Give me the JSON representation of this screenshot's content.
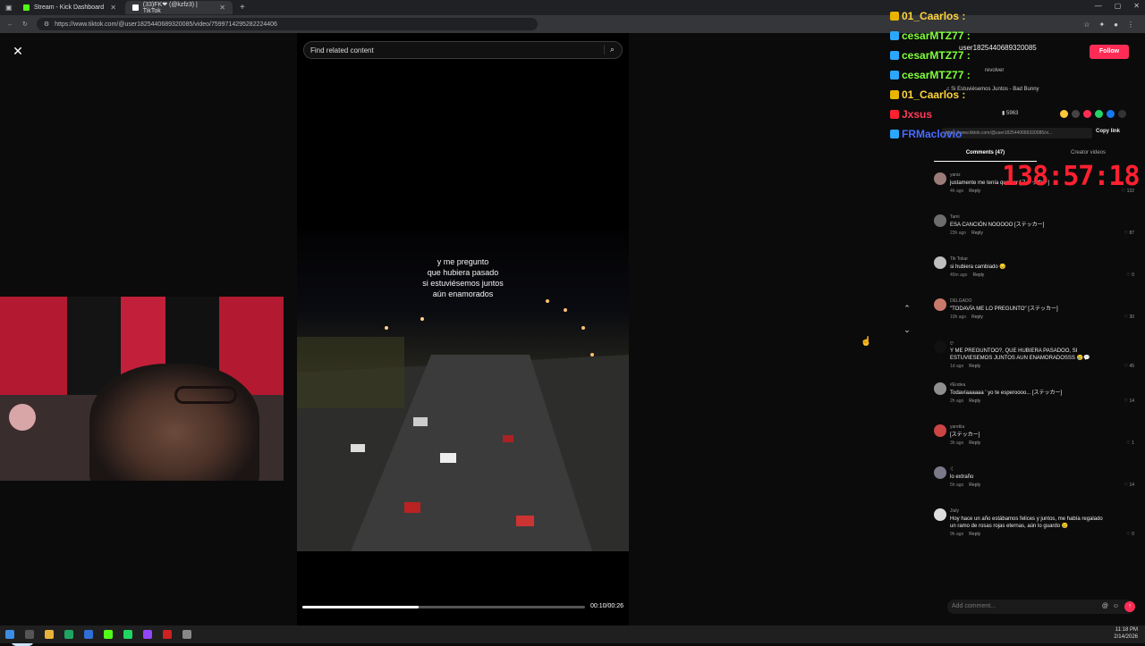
{
  "browser": {
    "tabs": [
      {
        "label": "Stream - Kick Dashboard",
        "fav_color": "#53fc18"
      },
      {
        "label": "(33)FK❤ (@kzfz3) | TikTok",
        "fav_color": "#ffffff"
      }
    ],
    "url": "https://www.tiktok.com/@user1825440689320085/video/7599714295282224406",
    "new_tab": "+"
  },
  "video": {
    "search_placeholder": "Find related content",
    "caption_lines": [
      "y me pregunto",
      "que hubiera pasado",
      "si estuviésemos juntos",
      "aún enamorados"
    ],
    "time": "00:10/00:26",
    "progress": 0.41
  },
  "chat": [
    {
      "name": "01_Caarlos :",
      "color": "#ffd43a",
      "badge": "#e8b400"
    },
    {
      "name": "cesarMTZ77 :",
      "color": "#7fff3a",
      "badge": "#2aa8ff"
    },
    {
      "name": "cesarMTZ77 :",
      "color": "#7fff3a",
      "badge": "#2aa8ff"
    },
    {
      "name": "cesarMTZ77 :",
      "color": "#7fff3a",
      "badge": "#2aa8ff"
    },
    {
      "name": "01_Caarlos :",
      "color": "#ffd43a",
      "badge": "#e8b400"
    },
    {
      "name": "Jxsus",
      "color": "#ff3a5a",
      "badge": "#ff2030"
    },
    {
      "name": "FRMaclovio",
      "color": "#4a6cff",
      "badge": "#2aa8ff"
    }
  ],
  "panel": {
    "username": "user1825440689320085",
    "follow_label": "Follow",
    "subtitle": "revolver",
    "music": "♫ Si Estuviésemos Juntos - Bad Bunny",
    "saves": "5963",
    "share_link": "https://www.tiktok.com/@user1825440689320085/vi...",
    "copy_link": "Copy link",
    "tab_comments": "Comments (47)",
    "tab_creator": "Creator videos",
    "comments": [
      {
        "user": "yaniz",
        "text": "justamente me tenía que ser [ステッカー]",
        "time": "4h ago",
        "likes": "132",
        "av": "#9a7b76"
      },
      {
        "user": "Tami",
        "text": "ESA CANCIÓN NOOOOO [ステッカー]",
        "time": "23h ago",
        "likes": "87",
        "av": "#6d6d6d"
      },
      {
        "user": "Tik Tokar",
        "text": "si hubiera cambiado 😔",
        "time": "40m ago",
        "likes": "0",
        "av": "#bfbfbf"
      },
      {
        "user": "DELGADO",
        "text": "\"TODAVÍA ME LO PREGUNTO\" [ステッカー]",
        "time": "10h ago",
        "likes": "30",
        "av": "#c9786c"
      },
      {
        "user": "ღ",
        "text": "Y ME PREGUNTOO?, QUE HUBIERA PASADOO, SI ESTUVIESEMOS JUNTOS AUN ENAMORADOSSS 😢💬",
        "time": "1d ago",
        "likes": "45",
        "av": "#111111"
      },
      {
        "user": "#Endea",
        "text": "Todavíaaaaaa ' yo te esperoooo... [ステッカー]",
        "time": "2h ago",
        "likes": "14",
        "av": "#8f8f8f"
      },
      {
        "user": "yaretiia",
        "text": "[ステッカー]",
        "time": "3h ago",
        "likes": "1",
        "av": "#c44"
      },
      {
        "user": ":(",
        "text": "lo extraño",
        "time": "5h ago",
        "likes": "14",
        "av": "#7a7a8a"
      },
      {
        "user": "Jiuly",
        "text": "Hoy hace un año estábamos felices y juntos, me había regalado un ramo de rosas rojas eternas, aún lo guardo 😢",
        "time": "9h ago",
        "likes": "0",
        "av": "#dddddd"
      }
    ],
    "reply_label": "Reply",
    "add_comment": "Add comment..."
  },
  "overlay_timer": "138:57:18",
  "clock": {
    "time": "11:18 PM",
    "date": "2/14/2026"
  }
}
